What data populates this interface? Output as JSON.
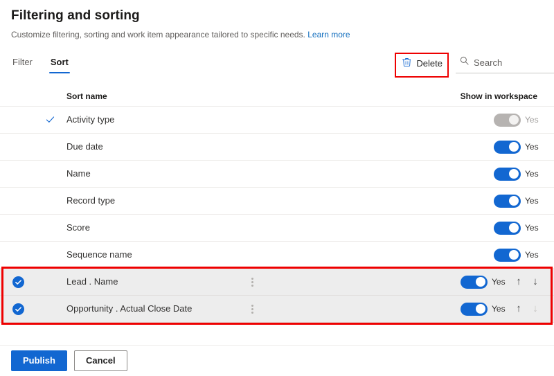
{
  "header": {
    "title": "Filtering and sorting",
    "subtitle": "Customize filtering, sorting and work item appearance tailored to specific needs.",
    "learn_more": "Learn more"
  },
  "tabs": [
    {
      "label": "Filter",
      "active": false
    },
    {
      "label": "Sort",
      "active": true
    }
  ],
  "commands": {
    "delete_label": "Delete",
    "delete_icon": "trash-icon",
    "search_icon": "search-icon",
    "search_placeholder": "Search",
    "search_value": ""
  },
  "table": {
    "columns": {
      "name": "Sort name",
      "show": "Show in workspace"
    },
    "rows": [
      {
        "name": "Activity type",
        "checked": true,
        "selected": false,
        "toggle": "on",
        "toggle_disabled": true,
        "yes_label": "Yes",
        "has_more": false,
        "has_arrows": false
      },
      {
        "name": "Due date",
        "checked": false,
        "selected": false,
        "toggle": "on",
        "toggle_disabled": false,
        "yes_label": "Yes",
        "has_more": false,
        "has_arrows": false
      },
      {
        "name": "Name",
        "checked": false,
        "selected": false,
        "toggle": "on",
        "toggle_disabled": false,
        "yes_label": "Yes",
        "has_more": false,
        "has_arrows": false
      },
      {
        "name": "Record type",
        "checked": false,
        "selected": false,
        "toggle": "on",
        "toggle_disabled": false,
        "yes_label": "Yes",
        "has_more": false,
        "has_arrows": false
      },
      {
        "name": "Score",
        "checked": false,
        "selected": false,
        "toggle": "on",
        "toggle_disabled": false,
        "yes_label": "Yes",
        "has_more": false,
        "has_arrows": false
      },
      {
        "name": "Sequence name",
        "checked": false,
        "selected": false,
        "toggle": "on",
        "toggle_disabled": false,
        "yes_label": "Yes",
        "has_more": false,
        "has_arrows": false
      },
      {
        "name": "Lead . Name",
        "checked": false,
        "selected": true,
        "toggle": "on",
        "toggle_disabled": false,
        "yes_label": "Yes",
        "has_more": true,
        "has_arrows": true,
        "move_up_enabled": true,
        "move_down_enabled": true
      },
      {
        "name": "Opportunity . Actual Close Date",
        "checked": false,
        "selected": true,
        "toggle": "on",
        "toggle_disabled": false,
        "yes_label": "Yes",
        "has_more": true,
        "has_arrows": true,
        "move_up_enabled": true,
        "move_down_enabled": false
      }
    ]
  },
  "footer": {
    "publish_label": "Publish",
    "cancel_label": "Cancel"
  },
  "colors": {
    "accent": "#1267d1",
    "highlight": "#ee0000",
    "selected_row": "#ededed",
    "toggle_on": "#1267d1",
    "toggle_disabled": "#b6b3b1"
  }
}
